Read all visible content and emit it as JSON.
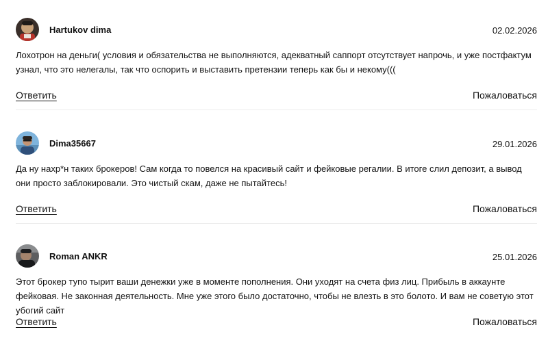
{
  "reviews": [
    {
      "author": "Hartukov dima",
      "date": "02.02.2026",
      "avatar_icon": "user-avatar-photo",
      "text": "Лохотрон на деньги( условия и обязательства не выполняются, адекватный саппорт отсутствует напрочь, и уже постфактум узнал, что это нелегалы, так что оспорить и выставить претензии теперь как бы и некому(((",
      "reply_label": "Ответить",
      "report_label": "Пожаловаться"
    },
    {
      "author": "Dima35667",
      "date": "29.01.2026",
      "avatar_icon": "user-avatar-photo",
      "text": "Да ну нахр*н таких брокеров! Сам когда то повелся на красивый сайт и фейковые регалии. В итоге слил депозит, а вывод они просто заблокировали. Это чистый скам, даже не пытайтесь!",
      "reply_label": "Ответить",
      "report_label": "Пожаловаться"
    },
    {
      "author": "Roman ANKR",
      "date": "25.01.2026",
      "avatar_icon": "user-avatar-photo",
      "text": "Этот брокер тупо тырит ваши денежки уже в моменте пополнения. Они уходят на счета физ лиц. Прибыль в аккаунте фейковая. Не законная деятельность. Мне уже этого было достаточно, чтобы не влезть в это болото. И вам не советую этот убогий сайт",
      "reply_label": "Ответить",
      "report_label": "Пожаловаться"
    }
  ]
}
